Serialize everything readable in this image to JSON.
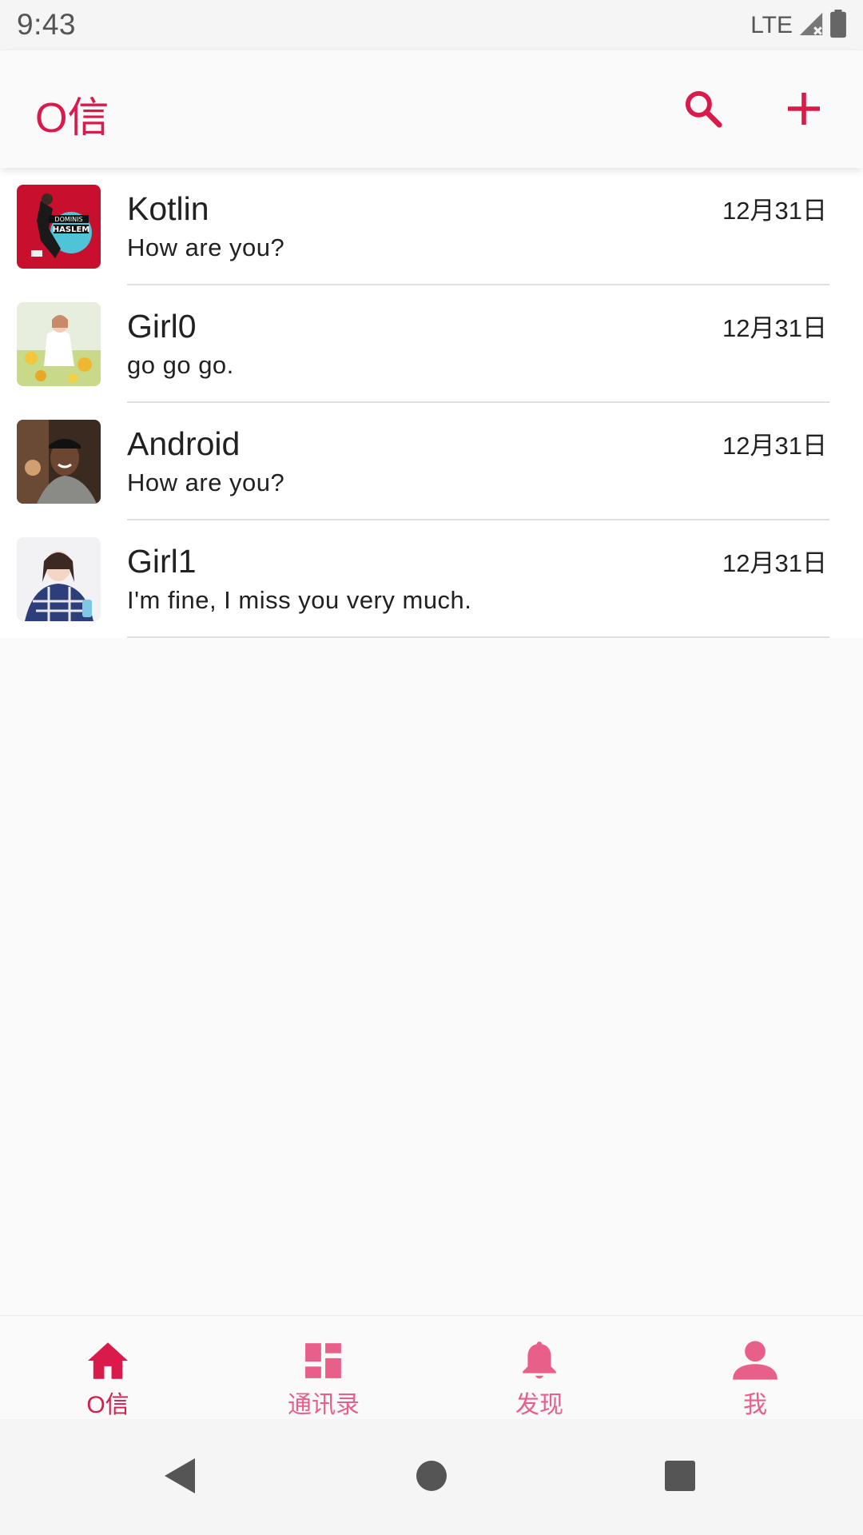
{
  "status_bar": {
    "time": "9:43",
    "network": "LTE"
  },
  "toolbar": {
    "title": "O信",
    "search_icon": "search-icon",
    "add_icon": "plus-icon"
  },
  "chats": [
    {
      "name": "Kotlin",
      "message": "How are you?",
      "time": "12月31日"
    },
    {
      "name": "Girl0",
      "message": "go go go.",
      "time": "12月31日"
    },
    {
      "name": "Android",
      "message": "How are you?",
      "time": "12月31日"
    },
    {
      "name": "Girl1",
      "message": "I'm fine, I miss you very much.",
      "time": "12月31日"
    }
  ],
  "bottom_nav": [
    {
      "label": "O信",
      "icon": "home-icon",
      "active": true
    },
    {
      "label": "通讯录",
      "icon": "dashboard-icon",
      "active": false
    },
    {
      "label": "发现",
      "icon": "bell-icon",
      "active": false
    },
    {
      "label": "我",
      "icon": "person-icon",
      "active": false
    }
  ],
  "colors": {
    "accent": "#d81b4a",
    "accent_light": "#e8608a",
    "background": "#fafafa"
  }
}
